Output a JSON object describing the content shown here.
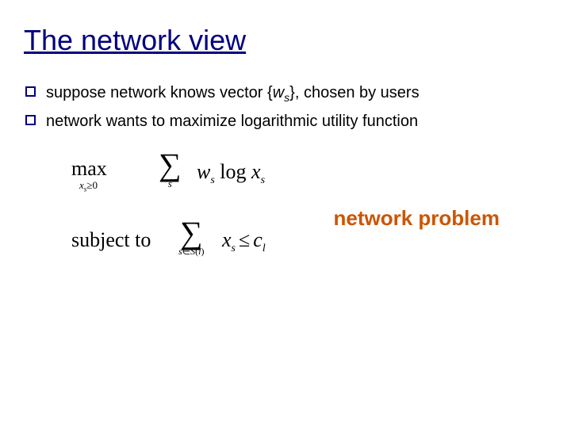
{
  "title": "The network view",
  "bullets": {
    "b1_pre": "suppose network knows vector {",
    "b1_var": "w",
    "b1_sub": "s",
    "b1_post": "}, chosen by users",
    "b2": "network wants to maximize logarithmic utility function"
  },
  "math": {
    "max": "max",
    "max_sub_var": "x",
    "max_sub_s": "s",
    "max_sub_ge0": "≥0",
    "sigma": "∑",
    "sum1_below": "s",
    "obj_w": "w",
    "obj_ws_sub": "s",
    "obj_log": " log ",
    "obj_x": "x",
    "obj_xs_sub": "s",
    "subject": "subject to",
    "sum2_below_s": "s",
    "sum2_below_in": "∈",
    "sum2_below_S": "S",
    "sum2_below_l": "l",
    "con_x": "x",
    "con_xs_sub": "s",
    "le": "≤",
    "con_c": "c",
    "con_cl_sub": "l"
  },
  "annotation": "network problem"
}
